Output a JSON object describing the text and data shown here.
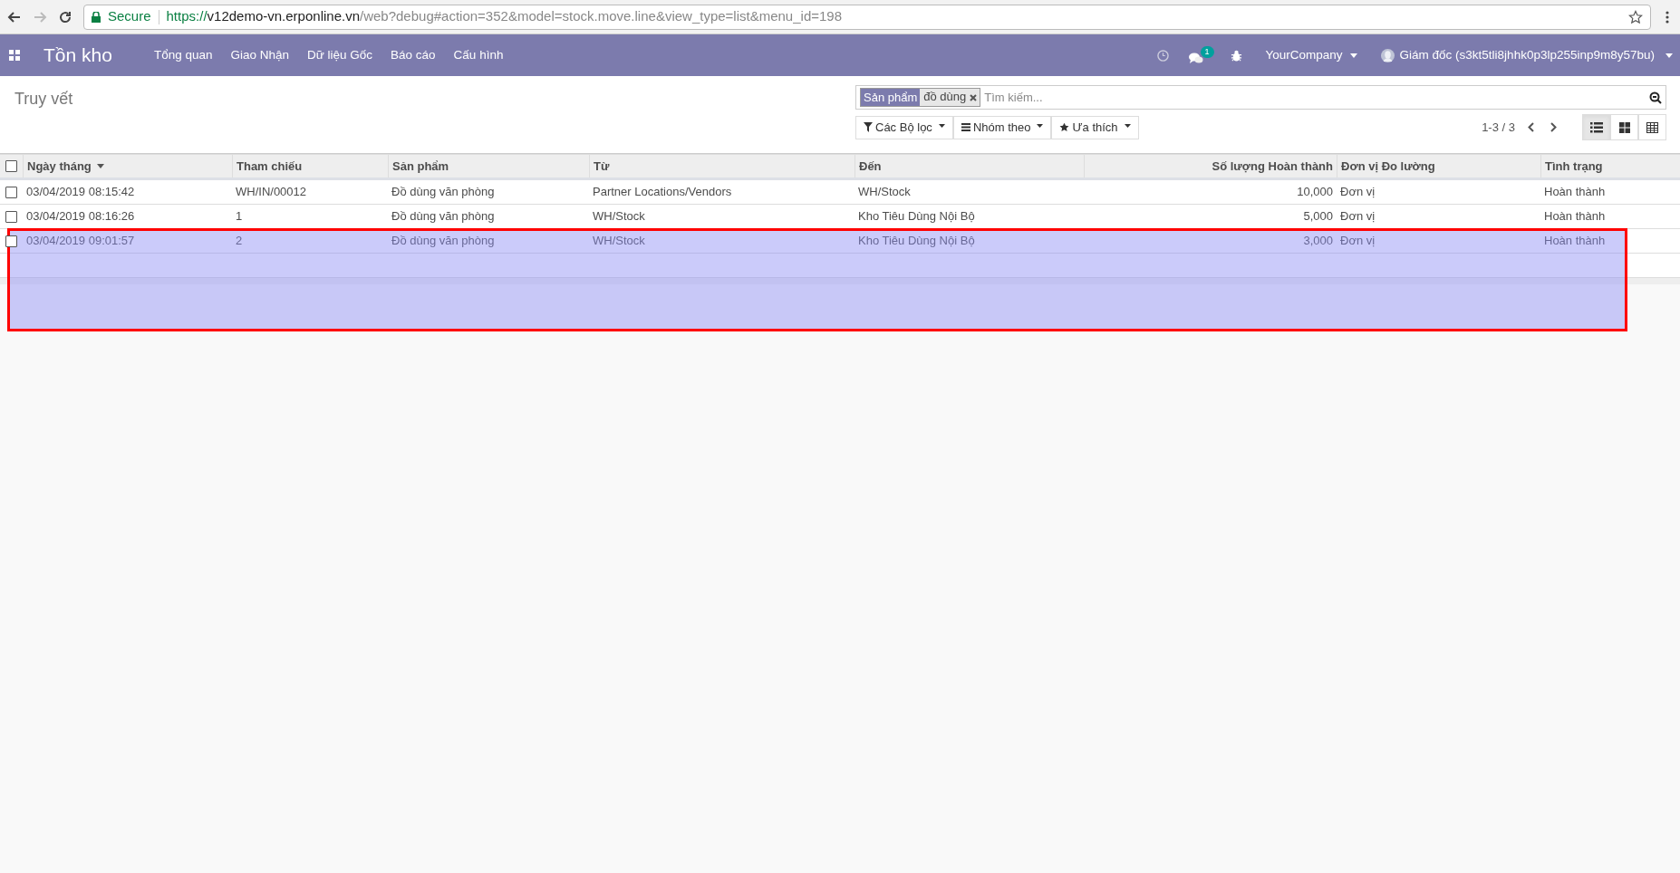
{
  "browser": {
    "secure_label": "Secure",
    "url_scheme": "https://",
    "url_host": "v12demo-vn.erponline.vn",
    "url_path": "/web?debug#action=352&model=stock.move.line&view_type=list&menu_id=198"
  },
  "navbar": {
    "app_title": "Tồn kho",
    "menu": [
      "Tổng quan",
      "Giao Nhận",
      "Dữ liệu Gốc",
      "Báo cáo",
      "Cấu hình"
    ],
    "messages_badge": "1",
    "company": "YourCompany",
    "user": "Giám đốc (s3kt5tli8jhhk0p3lp255inp9m8y57bu)"
  },
  "control_panel": {
    "breadcrumb": "Truy vết",
    "facet": {
      "label": "Sản phẩm",
      "value": "đồ dùng"
    },
    "search_placeholder": "Tìm kiếm...",
    "buttons": [
      {
        "kind": "filter",
        "label": "Các Bộ lọc"
      },
      {
        "kind": "group",
        "label": "Nhóm theo"
      },
      {
        "kind": "favorite",
        "label": "Ưa thích"
      }
    ],
    "pager": "1-3 / 3",
    "views": [
      {
        "kind": "list",
        "selected": true
      },
      {
        "kind": "kanban",
        "selected": false
      },
      {
        "kind": "pivot",
        "selected": false
      }
    ]
  },
  "table": {
    "select_all_checked": false,
    "columns": [
      {
        "label": "Ngày tháng",
        "sorted": true
      },
      {
        "label": "Tham chiếu",
        "sorted": false
      },
      {
        "label": "Sản phẩm",
        "sorted": false
      },
      {
        "label": "Từ",
        "sorted": false
      },
      {
        "label": "Đến",
        "sorted": false
      },
      {
        "label": "Số lượng Hoàn thành",
        "sorted": false
      },
      {
        "label": "Đơn vị Đo lường",
        "sorted": false
      },
      {
        "label": "Tình trạng",
        "sorted": false
      }
    ],
    "rows": [
      {
        "checked": false,
        "cells": [
          "03/04/2019 08:15:42",
          "WH/IN/00012",
          "Đồ dùng văn phòng",
          "Partner Locations/Vendors",
          "WH/Stock",
          "10,000",
          "Đơn vị",
          "Hoàn thành"
        ]
      },
      {
        "checked": false,
        "cells": [
          "03/04/2019 08:16:26",
          "1",
          "Đồ dùng văn phòng",
          "WH/Stock",
          "Kho Tiêu Dùng Nội Bộ",
          "5,000",
          "Đơn vị",
          "Hoàn thành"
        ]
      },
      {
        "checked": false,
        "cells": [
          "03/04/2019 09:01:57",
          "2",
          "Đồ dùng văn phòng",
          "WH/Stock",
          "Kho Tiêu Dùng Nội Bộ",
          "3,000",
          "Đơn vị",
          "Hoàn thành"
        ]
      }
    ]
  },
  "annotation": {
    "kind": "highlight_box"
  }
}
